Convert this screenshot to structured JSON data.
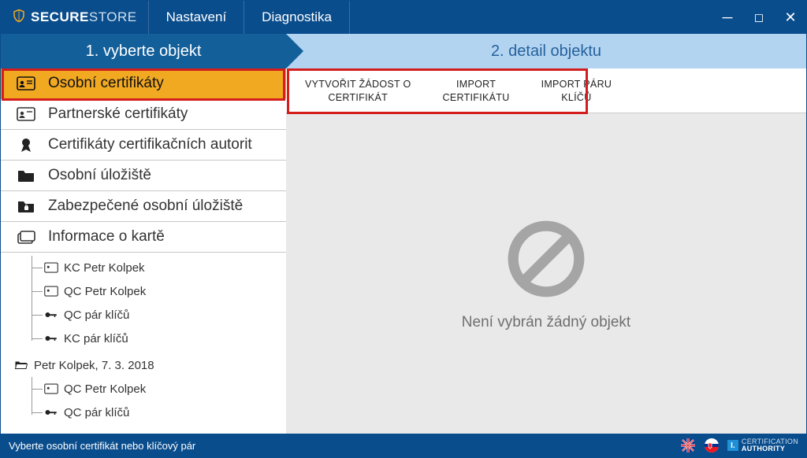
{
  "title": {
    "brand_bold": "SECURE",
    "brand_light": "STORE"
  },
  "menu": {
    "settings": "Nastavení",
    "diagnostics": "Diagnostika"
  },
  "steps": {
    "one": "1. vyberte objekt",
    "two": "2. detail objektu"
  },
  "categories": {
    "personal_certs": "Osobní certifikáty",
    "partner_certs": "Partnerské certifikáty",
    "ca_certs": "Certifikáty certifikačních autorit",
    "personal_store": "Osobní úložiště",
    "secure_store": "Zabezpečené osobní úložiště",
    "card_info": "Informace o kartě"
  },
  "tree": {
    "group_a": {
      "items": [
        {
          "label": "KC Petr Kolpek",
          "type": "cert"
        },
        {
          "label": "QC Petr Kolpek",
          "type": "cert"
        },
        {
          "label": "QC pár klíčů",
          "type": "key"
        },
        {
          "label": "KC pár klíčů",
          "type": "key"
        }
      ]
    },
    "group_b": {
      "header": "Petr Kolpek, 7. 3. 2018",
      "items": [
        {
          "label": "QC Petr Kolpek",
          "type": "cert"
        },
        {
          "label": "QC pár klíčů",
          "type": "key"
        }
      ]
    }
  },
  "actions": {
    "create_request_l1": "VYTVOŘIT ŽÁDOST O",
    "create_request_l2": "CERTIFIKÁT",
    "import_cert_l1": "IMPORT",
    "import_cert_l2": "CERTIFIKÁTU",
    "import_keys_l1": "IMPORT PÁRU",
    "import_keys_l2": "KLÍČŮ"
  },
  "empty_text": "Není vybrán žádný objekt",
  "status": {
    "message": "Vyberte osobní certifikát nebo klíčový pár",
    "ca_top": "CERTIFICATION",
    "ca_bot": "AUTHORITY"
  }
}
